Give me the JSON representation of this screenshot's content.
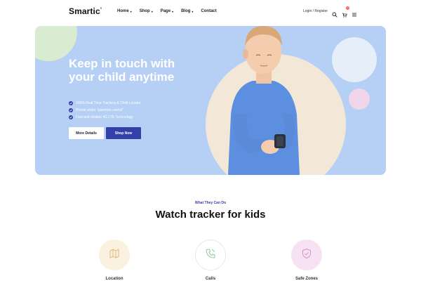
{
  "brand": {
    "name": "Smartic",
    "mark": "°"
  },
  "nav": {
    "items": [
      {
        "label": "Home",
        "has_dropdown": true
      },
      {
        "label": "Shop",
        "has_dropdown": true
      },
      {
        "label": "Page",
        "has_dropdown": true
      },
      {
        "label": "Blog",
        "has_dropdown": true
      },
      {
        "label": "Contact",
        "has_dropdown": false
      }
    ],
    "caret": "▾",
    "login": "Login / Register",
    "icons": [
      "search-icon",
      "cart-icon",
      "menu-icon"
    ],
    "cart_count": "0"
  },
  "hero": {
    "title": "Keep in touch with your child anytime",
    "features": [
      "100% Real Time Tracking & Child Locator",
      "Phone under \"parental control\"",
      "Fast and reliable 4G LTE Technology"
    ],
    "buttons": {
      "more": "More Details",
      "shop": "Shop Now"
    }
  },
  "section": {
    "eyebrow": "What They Can Do",
    "title": "Watch tracker for kids",
    "cards": [
      {
        "icon": "map-icon",
        "label": "Location"
      },
      {
        "icon": "phone-icon",
        "label": "Calls"
      },
      {
        "icon": "shield-icon",
        "label": "Safe Zones"
      }
    ]
  },
  "colors": {
    "hero_bg": "#b5cff5",
    "accent": "#3440a8",
    "map_tint": "#fbf1e1",
    "shield_tint": "#f6e2f3"
  }
}
